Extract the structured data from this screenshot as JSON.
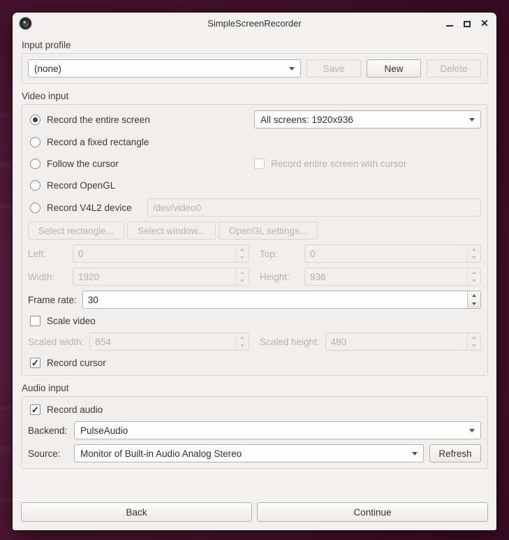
{
  "window": {
    "title": "SimpleScreenRecorder",
    "close_icon": "✕"
  },
  "icons": {
    "app_icon": "camera-lens",
    "minimize_icon": "underscore-shape",
    "maximize_icon": "square-outline-shape",
    "close_icon": "✕",
    "dropdown_arrow_icon": "down-triangle-shape",
    "spin_up_icon": "up-triangle-shape",
    "spin_down_icon": "down-triangle-shape",
    "check_icon": "✓"
  },
  "colors": {
    "wallpaper": "#4d1634",
    "window_bg": "#f2f1ef",
    "groupbox_border": "#d9d5d1",
    "field_border": "#b5b1ad",
    "disabled_text": "#b4b1ad",
    "text": "#3a3938"
  },
  "input_profile": {
    "section_label": "Input profile",
    "profile_value": "(none)",
    "save_label": "Save",
    "new_label": "New",
    "delete_label": "Delete"
  },
  "video_input": {
    "section_label": "Video input",
    "radio_entire_screen": "Record the entire screen",
    "screen_dropdown_value": "All screens: 1920x936",
    "radio_fixed_rectangle": "Record a fixed rectangle",
    "radio_follow_cursor": "Follow the cursor",
    "checkbox_entire_screen_with_cursor": "Record entire screen with cursor",
    "radio_opengl": "Record OpenGL",
    "radio_v4l2": "Record V4L2 device",
    "v4l2_device_value": "/dev/video0",
    "select_rectangle_label": "Select rectangle...",
    "select_window_label": "Select window...",
    "opengl_settings_label": "OpenGL settings...",
    "left_label": "Left:",
    "left_value": "0",
    "top_label": "Top:",
    "top_value": "0",
    "width_label": "Width:",
    "width_value": "1920",
    "height_label": "Height:",
    "height_value": "936",
    "frame_rate_label": "Frame rate:",
    "frame_rate_value": "30",
    "checkbox_scale_video": "Scale video",
    "scaled_width_label": "Scaled width:",
    "scaled_width_value": "854",
    "scaled_height_label": "Scaled height:",
    "scaled_height_value": "480",
    "checkbox_record_cursor": "Record cursor"
  },
  "audio_input": {
    "section_label": "Audio input",
    "checkbox_record_audio": "Record audio",
    "backend_label": "Backend:",
    "backend_value": "PulseAudio",
    "source_label": "Source:",
    "source_value": "Monitor of Built-in Audio Analog Stereo",
    "refresh_label": "Refresh"
  },
  "footer": {
    "back_label": "Back",
    "continue_label": "Continue"
  }
}
